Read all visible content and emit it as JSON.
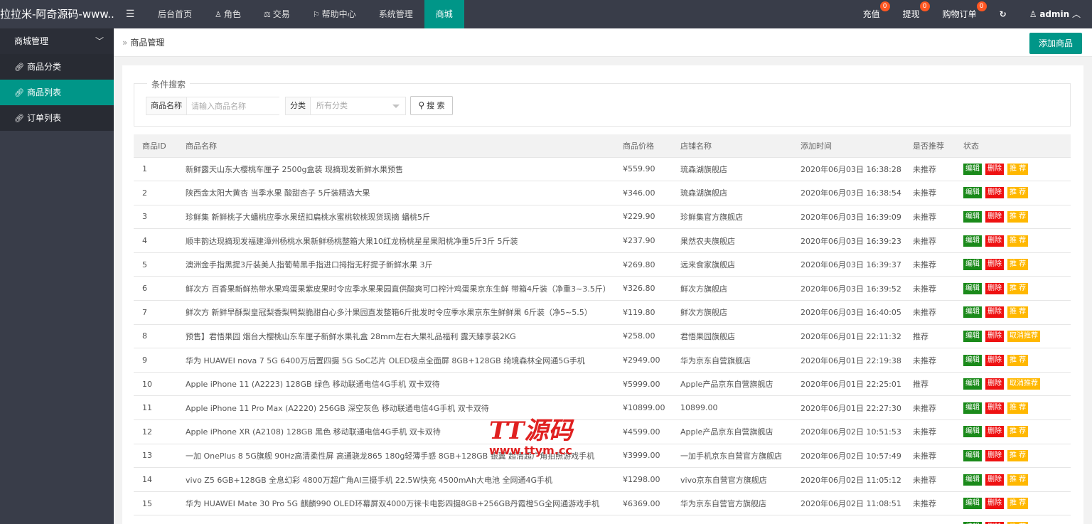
{
  "app": {
    "title": "拉拉米-阿奇源码-www..."
  },
  "topnav": {
    "toggle_icon": "menu-icon",
    "items": [
      {
        "label": "后台首页"
      },
      {
        "label": "角色",
        "icon": "user-icon"
      },
      {
        "label": "交易",
        "icon": "scale-icon"
      },
      {
        "label": "帮助中心",
        "icon": "flag-icon"
      },
      {
        "label": "系统管理"
      },
      {
        "label": "商城",
        "active": true
      }
    ]
  },
  "topright": {
    "recharge": {
      "label": "充值",
      "badge": "0"
    },
    "withdraw": {
      "label": "提现",
      "badge": "0"
    },
    "orders": {
      "label": "购物订单",
      "badge": "0"
    },
    "refresh_icon": "refresh-icon",
    "user": {
      "label": "admin"
    }
  },
  "sidebar": {
    "group": "商城管理",
    "items": [
      {
        "label": "商品分类"
      },
      {
        "label": "商品列表",
        "active": true
      },
      {
        "label": "订单列表"
      }
    ]
  },
  "breadcrumb": {
    "current": "商品管理"
  },
  "toolbar": {
    "add_label": "添加商品"
  },
  "search": {
    "legend": "条件搜索",
    "name_label": "商品名称",
    "name_placeholder": "请输入商品名称",
    "category_label": "分类",
    "category_value": "所有分类",
    "button_label": "搜 索"
  },
  "table": {
    "headers": [
      "商品ID",
      "商品名称",
      "商品价格",
      "店铺名称",
      "添加时间",
      "是否推荐",
      "状态"
    ],
    "actions": {
      "edit": "编辑",
      "delete": "删除",
      "recommend": "推 荐",
      "unrecommend": "取消推荐"
    },
    "rows": [
      {
        "id": "1",
        "name": "新鲜露天山东大樱桃车厘子 2500g盒装 现摘现发新鲜水果预售",
        "price": "¥559.90",
        "shop": "琉森湖旗舰店",
        "time": "2020年06月03日 16:38:28",
        "recommended": "未推荐",
        "action": "推 荐"
      },
      {
        "id": "2",
        "name": "陕西金太阳大黄杏 当季水果 酸甜杏子 5斤装精选大果",
        "price": "¥346.00",
        "shop": "琉森湖旗舰店",
        "time": "2020年06月03日 16:38:54",
        "recommended": "未推荐",
        "action": "推 荐"
      },
      {
        "id": "3",
        "name": "珍鲜集 新鲜桃子大蟠桃应季水果纽扣扁桃水蜜桃软桃现货现摘 蟠桃5斤",
        "price": "¥229.90",
        "shop": "珍鲜集官方旗舰店",
        "time": "2020年06月03日 16:39:09",
        "recommended": "未推荐",
        "action": "推 荐"
      },
      {
        "id": "4",
        "name": "顺丰韵达现摘现发福建漳州杨桃水果新鲜杨桃整箱大果10红龙杨桃星星果阳桃净重5斤3斤 5斤装",
        "price": "¥237.90",
        "shop": "果然农夫旗舰店",
        "time": "2020年06月03日 16:39:23",
        "recommended": "未推荐",
        "action": "推 荐"
      },
      {
        "id": "5",
        "name": "澳洲金手指黑提3斤装美人指葡萄黑手指进口拇指无籽提子新鲜水果 3斤",
        "price": "¥269.80",
        "shop": "远来食家旗舰店",
        "time": "2020年06月03日 16:39:37",
        "recommended": "未推荐",
        "action": "推 荐"
      },
      {
        "id": "6",
        "name": "鲜次方 百香果新鲜热带水果鸡蛋果紫皮果时令应季水果果园直供酸爽可口榨汁鸡蛋果京东生鲜 带箱4斤装（净重3~3.5斤）",
        "price": "¥326.80",
        "shop": "鲜次方旗舰店",
        "time": "2020年06月03日 16:39:52",
        "recommended": "未推荐",
        "action": "推 荐"
      },
      {
        "id": "7",
        "name": "鲜次方 新鲜早酥梨皇冠梨香梨鸭梨脆甜白心多汁果园直发整箱6斤批发时令应季水果京东生鲜鲜果 6斤装（净5~5.5）",
        "price": "¥119.80",
        "shop": "鲜次方旗舰店",
        "time": "2020年06月03日 16:40:05",
        "recommended": "未推荐",
        "action": "推 荐"
      },
      {
        "id": "8",
        "name": "预售】君悟果园 烟台大樱桃山东车厘子新鲜水果礼盒 28mm左右大果礼品福利 露天臻享装2KG",
        "price": "¥258.00",
        "shop": "君悟果园旗舰店",
        "time": "2020年06月01日 22:11:32",
        "recommended": "推荐",
        "action": "取消推荐"
      },
      {
        "id": "9",
        "name": "华为 HUAWEI nova 7 5G 6400万后置四摄 5G SoC芯片 OLED极点全面屏 8GB+128GB 绮境森林全网通5G手机",
        "price": "¥2949.00",
        "shop": "华为京东自营旗舰店",
        "time": "2020年06月01日 22:19:38",
        "recommended": "未推荐",
        "action": "推 荐"
      },
      {
        "id": "10",
        "name": "Apple iPhone 11 (A2223) 128GB 绿色 移动联通电信4G手机 双卡双待",
        "price": "¥5999.00",
        "shop": "Apple产品京东自营旗舰店",
        "time": "2020年06月01日 22:25:01",
        "recommended": "推荐",
        "action": "取消推荐"
      },
      {
        "id": "11",
        "name": "Apple iPhone 11 Pro Max (A2220) 256GB 深空灰色 移动联通电信4G手机 双卡双待",
        "price": "¥10899.00",
        "shop": "10899.00",
        "time": "2020年06月01日 22:27:30",
        "recommended": "未推荐",
        "action": "推 荐"
      },
      {
        "id": "12",
        "name": "Apple iPhone XR (A2108) 128GB 黑色 移动联通电信4G手机 双卡双待",
        "price": "¥4599.00",
        "shop": "Apple产品京东自营旗舰店",
        "time": "2020年06月02日 10:51:53",
        "recommended": "未推荐",
        "action": "推 荐"
      },
      {
        "id": "13",
        "name": "一加 OnePlus 8 5G旗舰 90Hz高清柔性屏 高通骁龙865 180g轻薄手感 8GB+128GB 银翼 超清超广角拍照游戏手机",
        "price": "¥3999.00",
        "shop": "一加手机京东自营官方旗舰店",
        "time": "2020年06月02日 10:57:49",
        "recommended": "未推荐",
        "action": "推 荐"
      },
      {
        "id": "14",
        "name": "vivo Z5 6GB+128GB 全息幻彩 4800万超广角AI三摄手机 22.5W快充 4500mAh大电池 全网通4G手机",
        "price": "¥1298.00",
        "shop": "vivo京东自营官方旗舰店",
        "time": "2020年06月02日 11:05:12",
        "recommended": "未推荐",
        "action": "推 荐"
      },
      {
        "id": "15",
        "name": "华为 HUAWEI Mate 30 Pro 5G 麒麟990 OLED环幕屏双4000万徕卡电影四摄8GB+256GB丹霞橙5G全网通游戏手机",
        "price": "¥6369.00",
        "shop": "华为京东自营官方旗舰店",
        "time": "2020年06月02日 11:08:51",
        "recommended": "未推荐",
        "action": "推 荐"
      },
      {
        "id": "",
        "name": "",
        "price": "",
        "shop": "",
        "time": "",
        "recommended": "",
        "action": "推 荐"
      }
    ]
  },
  "watermark": {
    "line1": "TT源码",
    "line2": "www.ttym.cc"
  },
  "colors": {
    "accent": "#009688",
    "topbar": "#393d49",
    "edit": "#1a8a1a",
    "delete": "#ee1111",
    "recommend": "#ffb800",
    "badge": "#ff5722"
  }
}
